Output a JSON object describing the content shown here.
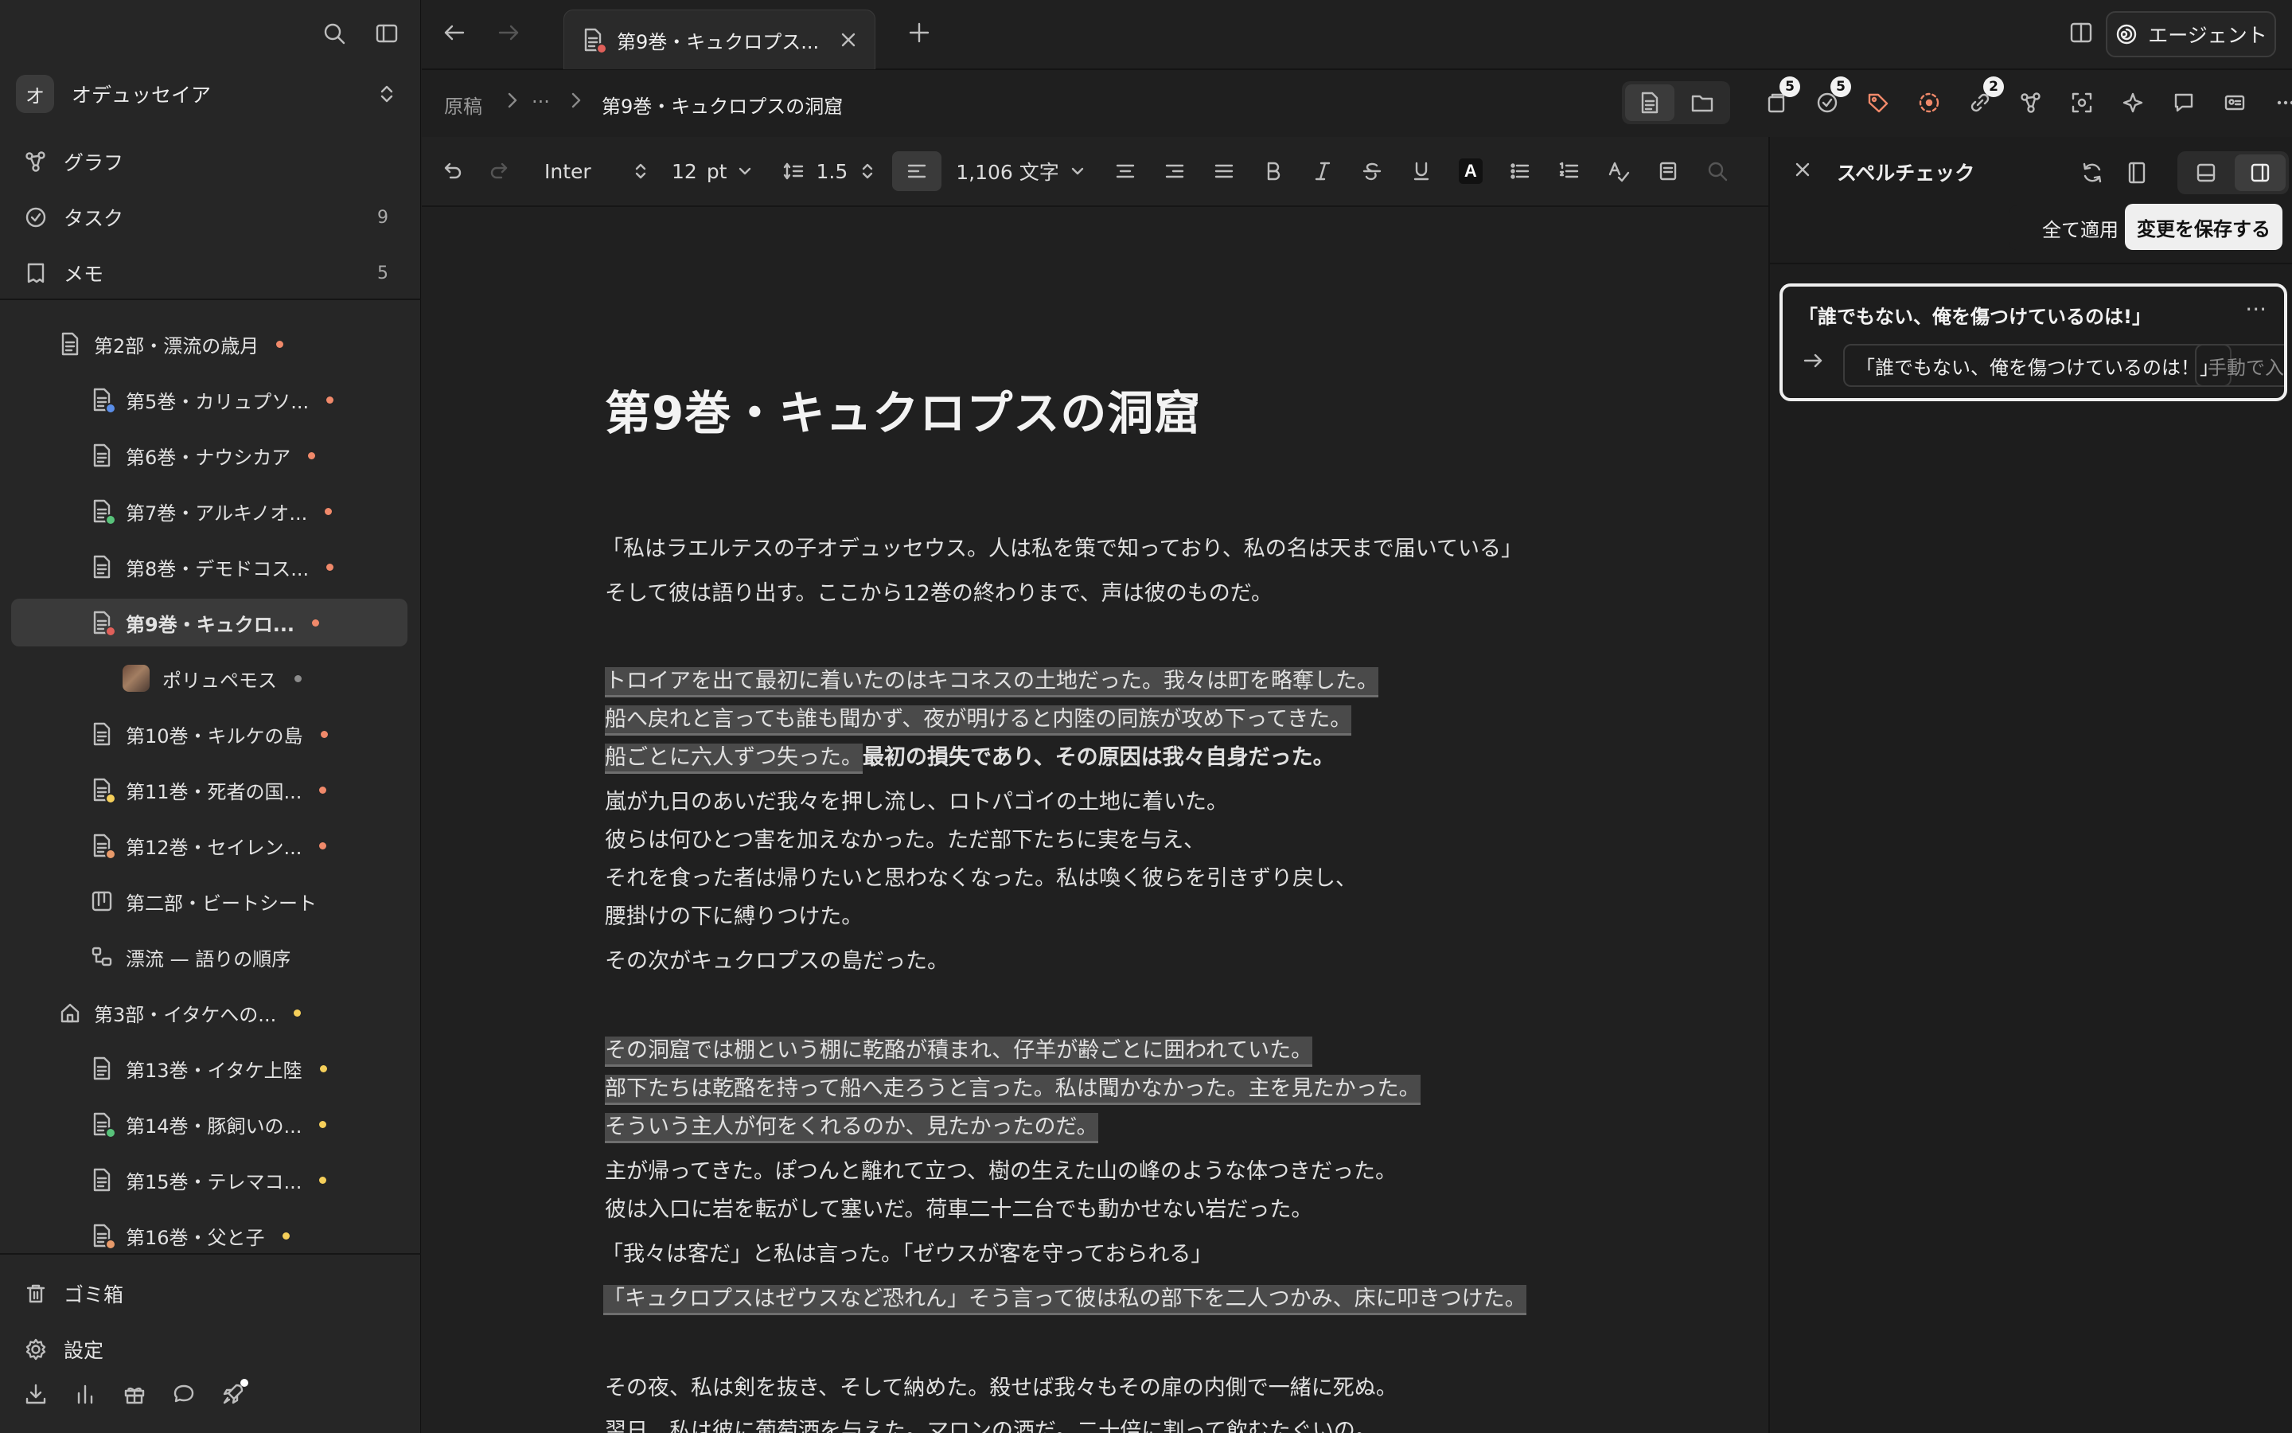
{
  "sidebar": {
    "workspace": {
      "initial": "オ",
      "name": "オデュッセイア"
    },
    "nav": [
      {
        "label": "グラフ",
        "count": ""
      },
      {
        "label": "タスク",
        "count": "9"
      },
      {
        "label": "メモ",
        "count": "5"
      }
    ],
    "tree": [
      {
        "label": "第2部・漂流の歳月",
        "dot": "#f0896a"
      },
      {
        "label": "第5巻・カリュプソ...",
        "dot": "#f0896a"
      },
      {
        "label": "第6巻・ナウシカア",
        "dot": "#f0896a"
      },
      {
        "label": "第7巻・アルキノオ...",
        "dot": "#f0896a"
      },
      {
        "label": "第8巻・デモドコス...",
        "dot": "#f0896a"
      },
      {
        "label": "第9巻・キュクロ...",
        "dot": "#f0896a"
      },
      {
        "label": "ポリュペモス",
        "dot": "#8c8c8c"
      },
      {
        "label": "第10巻・キルケの島",
        "dot": "#f0896a"
      },
      {
        "label": "第11巻・死者の国...",
        "dot": "#f0896a"
      },
      {
        "label": "第12巻・セイレン...",
        "dot": "#f0896a"
      },
      {
        "label": "第二部・ビートシート",
        "dot": ""
      },
      {
        "label": "漂流 — 語りの順序",
        "dot": ""
      },
      {
        "label": "第3部・イタケへの...",
        "dot": "#f5cf5a"
      },
      {
        "label": "第13巻・イタケ上陸",
        "dot": "#f5cf5a"
      },
      {
        "label": "第14巻・豚飼いの...",
        "dot": "#f5cf5a"
      },
      {
        "label": "第15巻・テレマコ...",
        "dot": "#f5cf5a"
      },
      {
        "label": "第16巻・父と子",
        "dot": "#f5cf5a"
      }
    ],
    "bottom": [
      {
        "label": "ゴミ箱"
      },
      {
        "label": "設定"
      }
    ]
  },
  "tabs": [
    {
      "title": "第9巻・キュクロプス..."
    }
  ],
  "agent_label": "エージェント",
  "breadcrumb": {
    "root": "原稿",
    "ellipsis": "···",
    "current": "第9巻・キュクロプスの洞窟"
  },
  "badges": {
    "pages": "5",
    "tasks": "5",
    "links": "2"
  },
  "format": {
    "font": "Inter",
    "size": "12",
    "unit": "pt",
    "line_height": "1.5",
    "word_count": "1,106 文字"
  },
  "document": {
    "title": "第9巻・キュクロプスの洞窟",
    "lines": [
      {
        "text": "「私はラエルテスの子オデュッセウス。人は私を策で知っており、私の名は天まで届いている」",
        "hl": false
      },
      {
        "text": "そして彼は語り出す。ここから12巻の終わりまで、声は彼のものだ。",
        "hl": false
      },
      {
        "text": "トロイアを出て最初に着いたのはキコネスの土地だった。我々は町を略奪した。",
        "hl": true
      },
      {
        "text": "船へ戻れと言っても誰も聞かず、夜が明けると内陸の同族が攻め下ってきた。",
        "hl": true
      },
      {
        "text": "船ごとに六人ずつ失った。",
        "hl": true,
        "bold_tail": "最初の損失であり、その原因は我々自身だった。"
      },
      {
        "text": "嵐が九日のあいだ我々を押し流し、ロトパゴイの土地に着いた。",
        "hl": false
      },
      {
        "text": "彼らは何ひとつ害を加えなかった。ただ部下たちに実を与え、",
        "hl": false
      },
      {
        "text": "それを食った者は帰りたいと思わなくなった。私は喚く彼らを引きずり戻し、",
        "hl": false
      },
      {
        "text": "腰掛けの下に縛りつけた。",
        "hl": false
      },
      {
        "text": "その次がキュクロプスの島だった。",
        "hl": false
      },
      {
        "text": "その洞窟では棚という棚に乾酪が積まれ、仔羊が齢ごとに囲われていた。",
        "hl": true
      },
      {
        "text": "部下たちは乾酪を持って船へ走ろうと言った。私は聞かなかった。主を見たかった。",
        "hl": true
      },
      {
        "text": "そういう主人が何をくれるのか、見たかったのだ。",
        "hl": true
      },
      {
        "text": "主が帰ってきた。ぽつんと離れて立つ、樹の生えた山の峰のような体つきだった。",
        "hl": false
      },
      {
        "text": "彼は入口に岩を転がして塞いだ。荷車二十二台でも動かせない岩だった。",
        "hl": false
      },
      {
        "text": "「我々は客だ」と私は言った。「ゼウスが客を守っておられる」",
        "hl": false
      },
      {
        "text": "「キュクロプスはゼウスなど恐れん」そう言って彼は私の部下を二人つかみ、床に叩きつけた。",
        "hl": true
      },
      {
        "text": "その夜、私は剣を抜き、そして納めた。殺せば我々もその扉の内側で一緒に死ぬ。",
        "hl": false
      },
      {
        "text": "翌日、私は彼に葡萄酒を与えた。マロンの酒だ。二十倍に割って飲むたぐいの。",
        "hl": false
      }
    ]
  },
  "spellcheck": {
    "title": "スペルチェック",
    "apply_all": "全て適用",
    "save": "変更を保存する",
    "issue": {
      "original": "「誰でもない、俺を傷つけているのは!」",
      "suggestion": "「誰でもない、俺を傷つけているのは！」",
      "manual": "手動で入力"
    }
  }
}
